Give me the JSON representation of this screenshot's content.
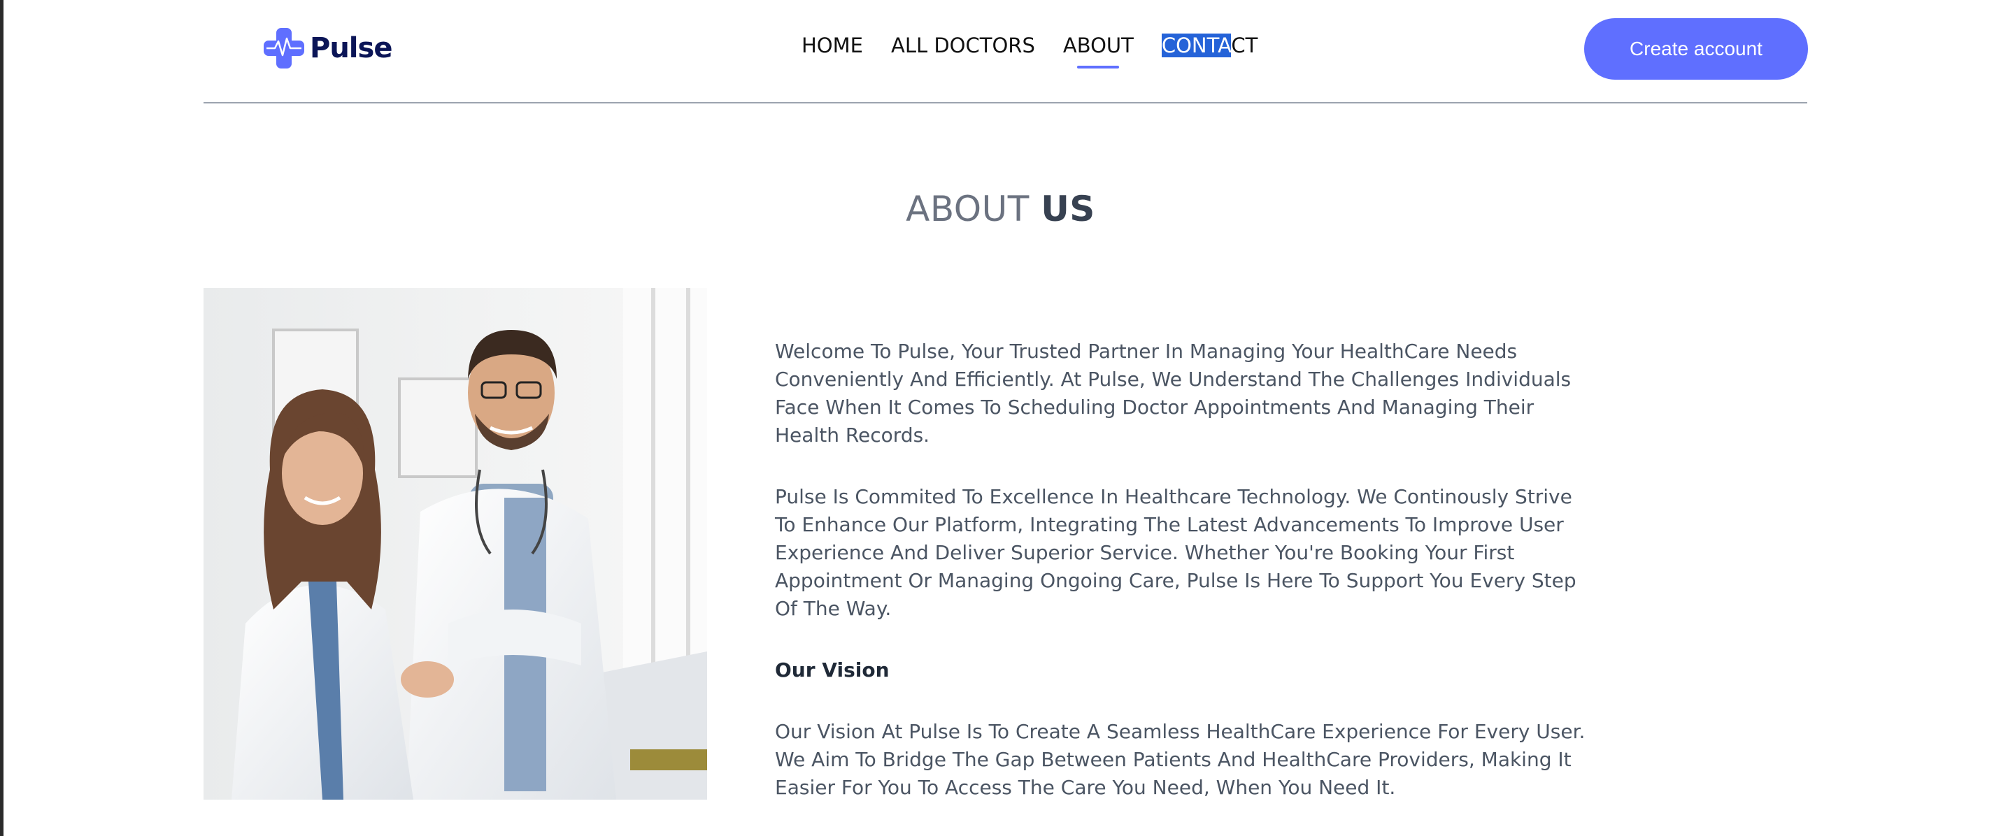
{
  "brand": {
    "name": "Pulse",
    "accent_color": "#5f6fff",
    "logo_icon": "medical-cross-pulse-icon"
  },
  "nav": {
    "items": [
      {
        "label": "HOME"
      },
      {
        "label": "ALL DOCTORS"
      },
      {
        "label": "ABOUT",
        "active": true
      },
      {
        "label_selected": "CONTA",
        "label_rest": "CT"
      }
    ]
  },
  "header": {
    "create_account_label": "Create account"
  },
  "title": {
    "part1": "ABOUT",
    "part2": "US"
  },
  "about": {
    "paragraph1": "Welcome To Pulse, Your Trusted Partner In Managing Your HealthCare Needs Conveniently And Efficiently. At Pulse, We Understand The Challenges Individuals Face When It Comes To Scheduling Doctor Appointments And Managing Their Health Records.",
    "paragraph2": "Pulse Is Commited To Excellence In Healthcare Technology. We Continously Strive To Enhance Our Platform, Integrating The Latest Advancements To Improve User Experience And Deliver Superior Service. Whether You're Booking Your First Appointment Or Managing Ongoing Care, Pulse Is Here To Support You Every Step Of The Way.",
    "vision_heading": "Our Vision",
    "vision_text": "Our Vision At Pulse Is To Create A Seamless HealthCare Experience For Every User. We Aim To Bridge The Gap Between Patients And HealthCare Providers, Making It Easier For You To Access The Care You Need, When You Need It."
  }
}
